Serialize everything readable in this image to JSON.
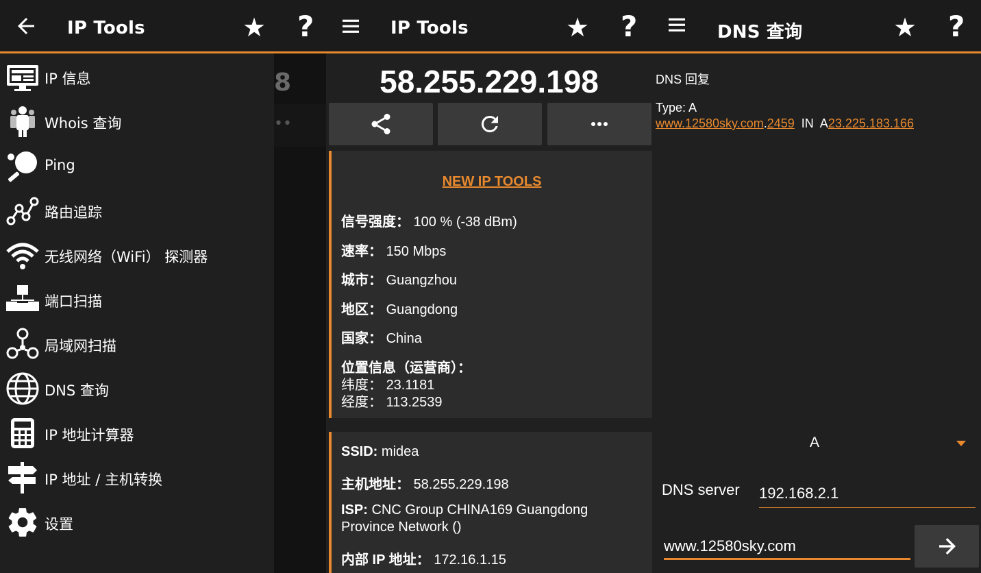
{
  "panel1": {
    "title": "IP Tools",
    "drawer_items": [
      {
        "label": "IP 信息",
        "icon": "monitor-icon"
      },
      {
        "label": "Whois 查询",
        "icon": "people-icon"
      },
      {
        "label": "Ping",
        "icon": "ping-pong-icon"
      },
      {
        "label": "路由追踪",
        "icon": "route-icon"
      },
      {
        "label": "无线网络（WiFi） 探测器",
        "icon": "wifi-icon"
      },
      {
        "label": "端口扫描",
        "icon": "port-scan-icon"
      },
      {
        "label": "局域网扫描",
        "icon": "lan-icon"
      },
      {
        "label": "DNS 查询",
        "icon": "globe-icon"
      },
      {
        "label": "IP 地址计算器",
        "icon": "calculator-icon"
      },
      {
        "label": "IP 地址 / 主机转换",
        "icon": "signpost-icon"
      },
      {
        "label": "设置",
        "icon": "gear-icon"
      }
    ]
  },
  "panel2": {
    "title": "IP Tools",
    "ip": "58.255.229.198",
    "card1": {
      "banner": "NEW IP TOOLS",
      "signal_label": "信号强度：",
      "signal_value": "100 % (-38 dBm)",
      "speed_label": "速率：",
      "speed_value": "150 Mbps",
      "city_label": "城市：",
      "city_value": "Guangzhou",
      "region_label": "地区：",
      "region_value": "Guangdong",
      "country_label": "国家：",
      "country_value": "China",
      "location_label": "位置信息（运营商）：",
      "lat_label": "纬度：",
      "lat_value": "23.1181",
      "lon_label": "经度：",
      "lon_value": "113.2539"
    },
    "card2": {
      "ssid_label": "SSID:",
      "ssid_value": "midea",
      "host_label": "主机地址：",
      "host_value": "58.255.229.198",
      "isp_label": "ISP:",
      "isp_value_line1": "CNC Group CHINA169 Guangdong",
      "isp_value_line2": "Province Network ()",
      "internal_label": "内部 IP 地址：",
      "internal_value": "172.16.1.15"
    }
  },
  "panel3": {
    "title": "DNS 查询",
    "reply_header": "DNS 回复",
    "type_line": "Type: A",
    "record_host": "www.12580sky.com",
    "record_dot": ".",
    "record_ttl": "2459",
    "record_mid": "  IN  A",
    "record_ip": "23.225.183.166",
    "record_type_selected": "A",
    "dns_server_label": "DNS server",
    "dns_server_value": "192.168.2.1",
    "query_value": "www.12580sky.com"
  },
  "colors": {
    "accent": "#e8892e",
    "background": "#202020",
    "card": "#2c2c2c",
    "button": "#3a3a3a"
  }
}
